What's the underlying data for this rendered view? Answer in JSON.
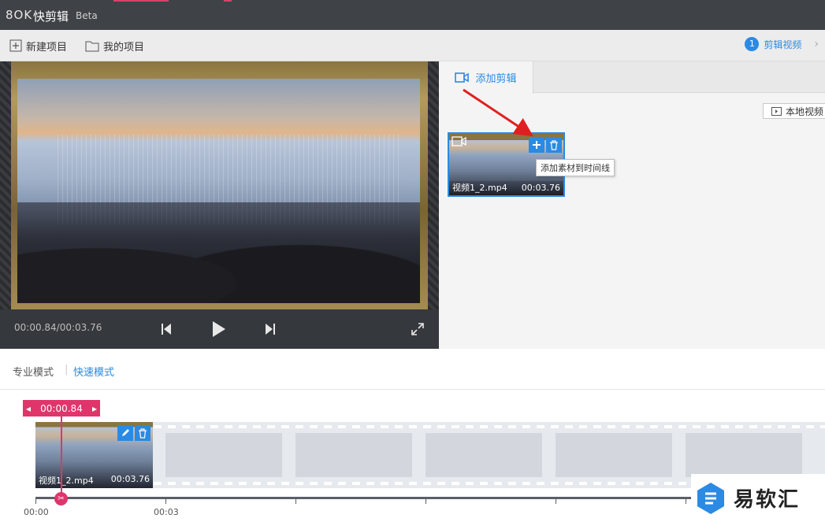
{
  "titlebar": {
    "logo": "8OK",
    "app_name": "快剪辑",
    "badge": "Beta"
  },
  "toolbar": {
    "new_project": "新建项目",
    "my_projects": "我的项目",
    "step_number": "1",
    "step_label": "剪辑视频"
  },
  "preview": {
    "time_readout": "00:00.84/00:03.76",
    "icons": [
      "skip-back-icon",
      "play-icon",
      "skip-forward-icon",
      "fullscreen-icon"
    ]
  },
  "right_panel": {
    "tab_label": "添加剪辑",
    "local_video_button": "本地视频",
    "clip": {
      "filename": "视频1_2.mp4",
      "duration": "00:03.76"
    },
    "tooltip": "添加素材到时间线"
  },
  "modes": {
    "pro": "专业模式",
    "quick": "快速模式"
  },
  "timeline": {
    "playhead_time": "00:00.84",
    "clip": {
      "filename": "视频1_2.mp4",
      "duration": "00:03.76"
    },
    "ruler_labels": [
      "00:00",
      "00:03"
    ]
  },
  "watermark": {
    "text": "易软汇"
  },
  "colors": {
    "accent": "#2b8ae3",
    "playhead": "#e0356b",
    "annotation_arrow": "#e02020"
  }
}
